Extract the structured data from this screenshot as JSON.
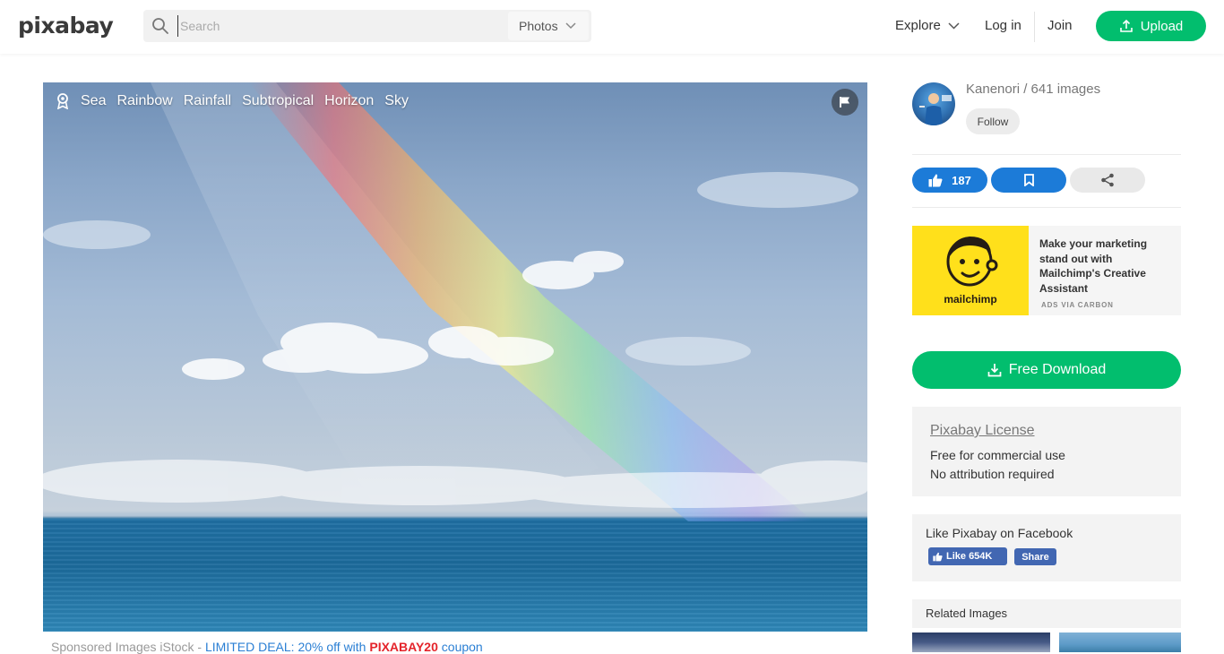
{
  "header": {
    "logo": "pixabay",
    "search_placeholder": "Search",
    "search_type": "Photos",
    "explore": "Explore",
    "login": "Log in",
    "join": "Join",
    "upload": "Upload"
  },
  "photo": {
    "tags": [
      "Sea",
      "Rainbow",
      "Rainfall",
      "Subtropical",
      "Horizon",
      "Sky"
    ]
  },
  "sponsored": {
    "prefix": "Sponsored Images iStock - ",
    "deal": "LIMITED DEAL: 20% off with ",
    "code": "PIXABAY20",
    "suffix": " coupon"
  },
  "author": {
    "name_line": "Kanenori / 641 images",
    "follow": "Follow"
  },
  "actions": {
    "likes": "187"
  },
  "ad": {
    "brand": "mailchimp",
    "text": "Make your marketing stand out with Mailchimp's Creative Assistant",
    "via": "ADS VIA CARBON"
  },
  "download": {
    "label": "Free Download"
  },
  "license": {
    "title": "Pixabay License",
    "line1": "Free for commercial use",
    "line2": "No attribution required"
  },
  "facebook": {
    "title": "Like Pixabay on Facebook",
    "like_label": "Like 654K",
    "share_label": "Share"
  },
  "related": {
    "title": "Related Images"
  },
  "colors": {
    "brand_green": "#02be6e",
    "action_blue": "#1c7bd8",
    "facebook_blue": "#4267b2",
    "deal_red": "#e4242b"
  }
}
